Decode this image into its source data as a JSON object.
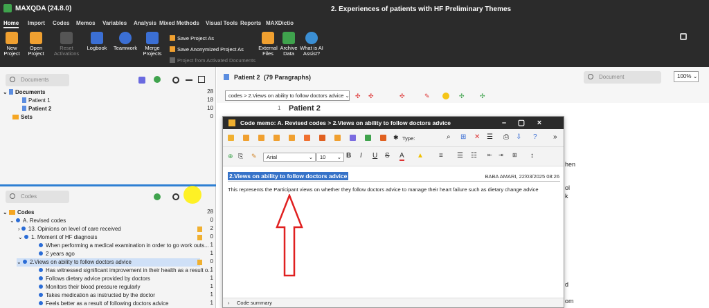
{
  "window": {
    "app_title": "MAXQDA (24.8.0)",
    "doc_title": "2. Experiences of patients with HF Preliminary Themes"
  },
  "menu": [
    "Home",
    "Import",
    "Codes",
    "Memos",
    "Variables",
    "Analysis",
    "Mixed Methods",
    "Visual Tools",
    "Reports",
    "MAXDictio"
  ],
  "ribbon": {
    "new_project": "New Project",
    "open_project": "Open Project",
    "reset": "Reset Activations",
    "logbook": "Logbook",
    "teamwork": "Teamwork",
    "merge": "Merge Projects",
    "save_as": "Save Project As",
    "save_anon": "Save Anonymized Project As",
    "from_activated": "Project from Activated Documents",
    "external": "External Files",
    "archive": "Archive Data",
    "ai": "What is AI Assist?"
  },
  "documents_pane": {
    "search_placeholder": "Documents",
    "rows": [
      {
        "label": "Documents",
        "count": "28"
      },
      {
        "label": "Patient 1",
        "count": "18"
      },
      {
        "label": "Patient 2",
        "count": "10"
      },
      {
        "label": "Sets",
        "count": "0"
      }
    ]
  },
  "codes_pane": {
    "search_placeholder": "Codes",
    "rows": [
      {
        "label": "Codes",
        "count": "28"
      },
      {
        "label": "A. Revised codes",
        "count": "0"
      },
      {
        "label": "13. Opinions on level of care received",
        "count": "2"
      },
      {
        "label": "1. Moment of HF diagnosis",
        "count": "0"
      },
      {
        "label": "When performing a medical examination in order to go work outs...",
        "count": "1"
      },
      {
        "label": "2 years ago",
        "count": "1"
      },
      {
        "label": "2.Views on ability to follow doctors advice",
        "count": "0"
      },
      {
        "label": "Has witnessed significant improvement in their health as a result o...",
        "count": "1"
      },
      {
        "label": "Follows dietary advice provided by doctors",
        "count": "1"
      },
      {
        "label": "Monitors their blood pressure regularly",
        "count": "1"
      },
      {
        "label": "Takes medication as instructed by the doctor",
        "count": "1"
      },
      {
        "label": "Feels better as a result of following doctors advice",
        "count": "1"
      }
    ]
  },
  "document_browser": {
    "title": "Patient 2",
    "paragraphs": "(79 Paragraphs)",
    "search_placeholder": "Document",
    "zoom": "100%",
    "code_path": "codes > 2.Views on ability to follow doctors advice",
    "para_num": "1",
    "heading": "Patient 2",
    "partial_words": [
      "hen",
      "ol",
      "k",
      "d",
      "om",
      "."
    ]
  },
  "memo_dialog": {
    "title": "Code memo: A. Revised codes > 2.Views on ability to follow doctors advice",
    "type_label": "Type:",
    "font": "Arial",
    "size": "10",
    "memo_title": "2.Views on ability to follow doctors advice",
    "meta": "BABA  AMARI, 22/03/2025 08:26",
    "body": "This represents the Participant views on whether they follow doctors advice to manage their heart failure such as dietary change advice",
    "footer": "Code summary"
  }
}
